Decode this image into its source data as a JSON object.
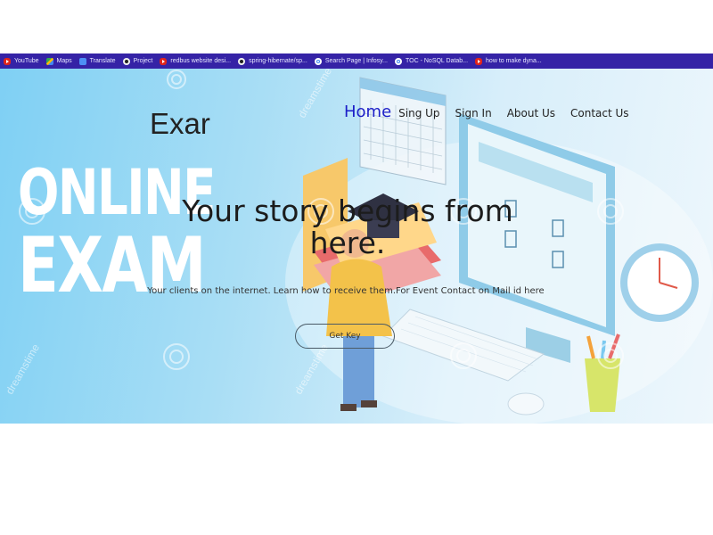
{
  "bookmarks": [
    {
      "label": "YouTube",
      "icon": "youtube-icon"
    },
    {
      "label": "Maps",
      "icon": "maps-icon"
    },
    {
      "label": "Translate",
      "icon": "translate-icon"
    },
    {
      "label": "Project",
      "icon": "github-icon"
    },
    {
      "label": "redbus website desi...",
      "icon": "youtube-icon"
    },
    {
      "label": "spring-hibernate/sp...",
      "icon": "github-icon"
    },
    {
      "label": "Search Page | Infosy...",
      "icon": "google-icon"
    },
    {
      "label": "TOC - NoSQL Datab...",
      "icon": "google-icon"
    },
    {
      "label": "how to make dyna...",
      "icon": "youtube-icon"
    }
  ],
  "brand": {
    "text": "Exar"
  },
  "hero_image": {
    "line1": "ONLINE",
    "line2": "EXAM",
    "watermark": "dreamstime"
  },
  "nav": {
    "home": "Home",
    "signup": "Sing Up",
    "signin": "Sign In",
    "about": "About Us",
    "contact": "Contact Us"
  },
  "hero": {
    "headline": "Your story begins from here.",
    "subtext": "Your clients on the internet. Learn how to receive them.For Event Contact on Mail id here",
    "cta": "Get Key"
  },
  "colors": {
    "bookmarks_bar": "#3523a6",
    "nav_active": "#1c1ec8",
    "hero_bg": "#a9def5"
  }
}
